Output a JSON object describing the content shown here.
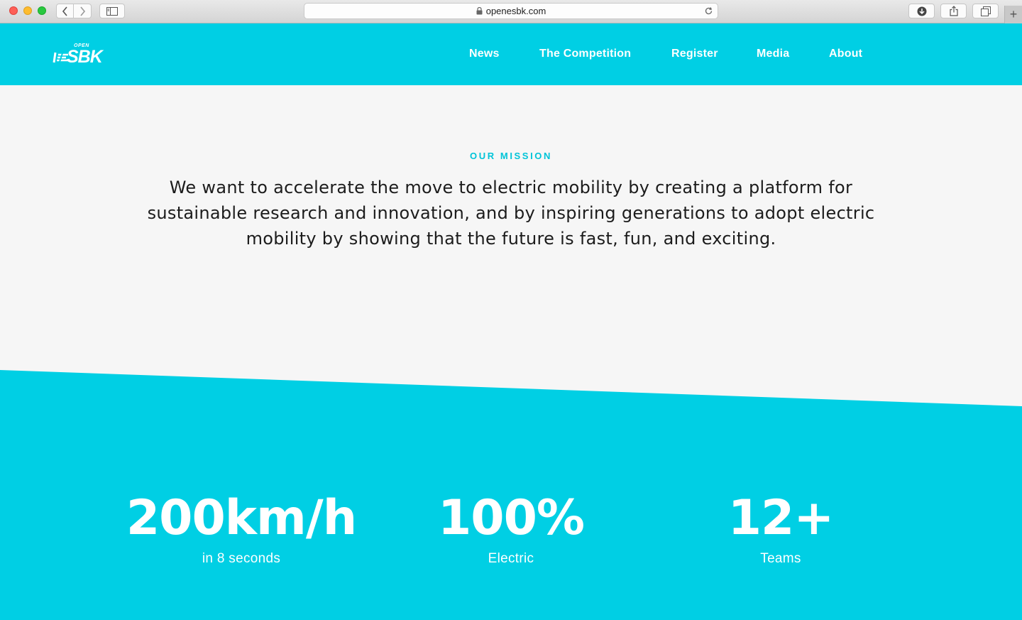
{
  "browser": {
    "url": "openesbk.com",
    "icons": {
      "back": "chevron-left-icon",
      "forward": "chevron-right-icon",
      "sidebar": "sidebar-icon",
      "lock": "lock-icon",
      "reload": "reload-icon",
      "download": "download-icon",
      "share": "share-icon",
      "tabs": "tabs-icon",
      "new_tab": "+"
    }
  },
  "header": {
    "logo": {
      "small": "OPEN",
      "word": "SBK"
    },
    "nav": [
      "News",
      "The Competition",
      "Register",
      "Media",
      "About"
    ]
  },
  "mission": {
    "label": "OUR MISSION",
    "text": "We want to accelerate the move to electric mobility by creating a platform for sustainable research and innovation, and by inspiring generations to adopt electric mobility by showing that the future is fast, fun, and exciting."
  },
  "stats": [
    {
      "value": "200km/h",
      "caption": "in 8 seconds"
    },
    {
      "value": "100%",
      "caption": "Electric"
    },
    {
      "value": "12+",
      "caption": "Teams"
    }
  ],
  "colors": {
    "accent": "#00cfe4",
    "label": "#00c4d8",
    "text": "#1c1c1c",
    "page_bg": "#f6f6f6"
  }
}
